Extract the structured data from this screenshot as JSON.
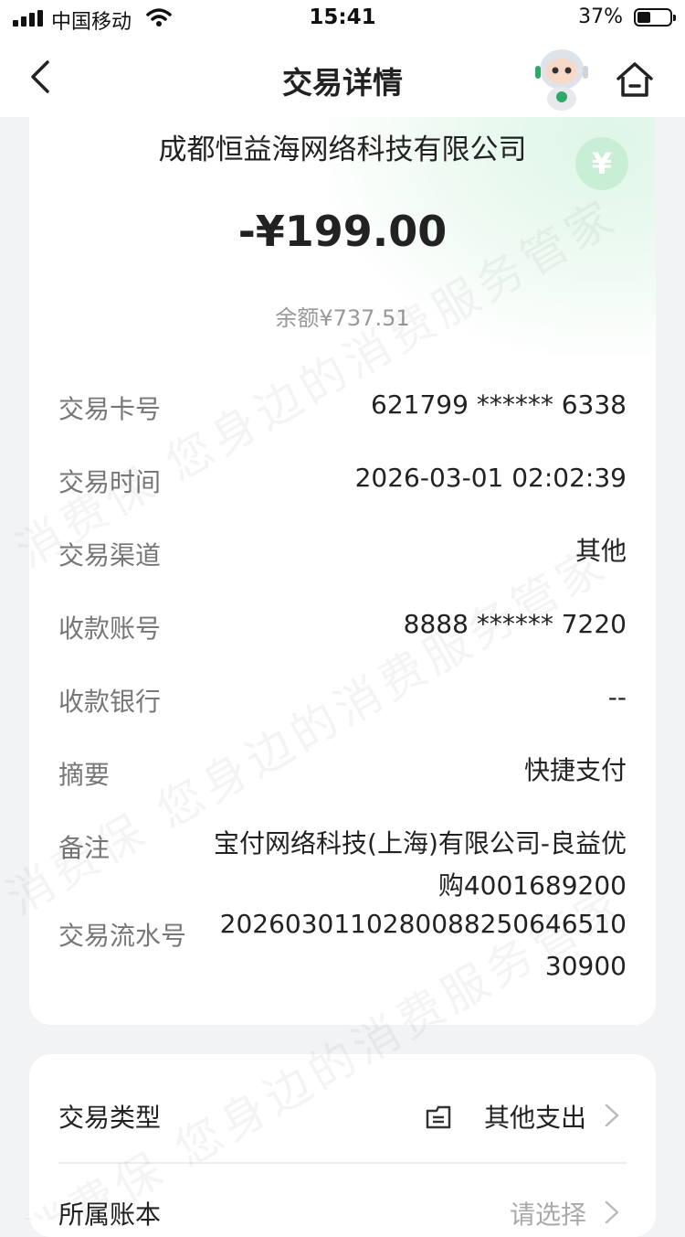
{
  "status_bar": {
    "carrier": "中国移动",
    "time": "15:41",
    "battery": "37%",
    "battery_level": 0.37
  },
  "nav": {
    "title": "交易详情"
  },
  "transaction": {
    "merchant": "成都恒益海网络科技有限公司",
    "amount": "-¥199.00",
    "balance": "余额¥737.51",
    "details": [
      {
        "label": "交易卡号",
        "value": "621799 ****** 6338"
      },
      {
        "label": "交易时间",
        "value": "2026-03-01 02:02:39"
      },
      {
        "label": "交易渠道",
        "value": "其他"
      },
      {
        "label": "收款账号",
        "value": "8888 ****** 7220"
      },
      {
        "label": "收款银行",
        "value": "--"
      },
      {
        "label": "摘要",
        "value": "快捷支付"
      },
      {
        "label": "备注",
        "value": "宝付网络科技(上海)有限公司-良益优购4001689200"
      },
      {
        "label": "交易流水号",
        "value": "202603011028008825064651030900"
      }
    ]
  },
  "classification": {
    "type_label": "交易类型",
    "type_value": "其他支出",
    "type_icon": "category-icon",
    "ledger_label": "所属账本",
    "ledger_value": "请选择"
  },
  "watermark": {
    "text": "消费保 您身边的消费服务管家"
  },
  "colors": {
    "accent_green": "#c8efd5",
    "page_bg": "#f2f3f5"
  }
}
